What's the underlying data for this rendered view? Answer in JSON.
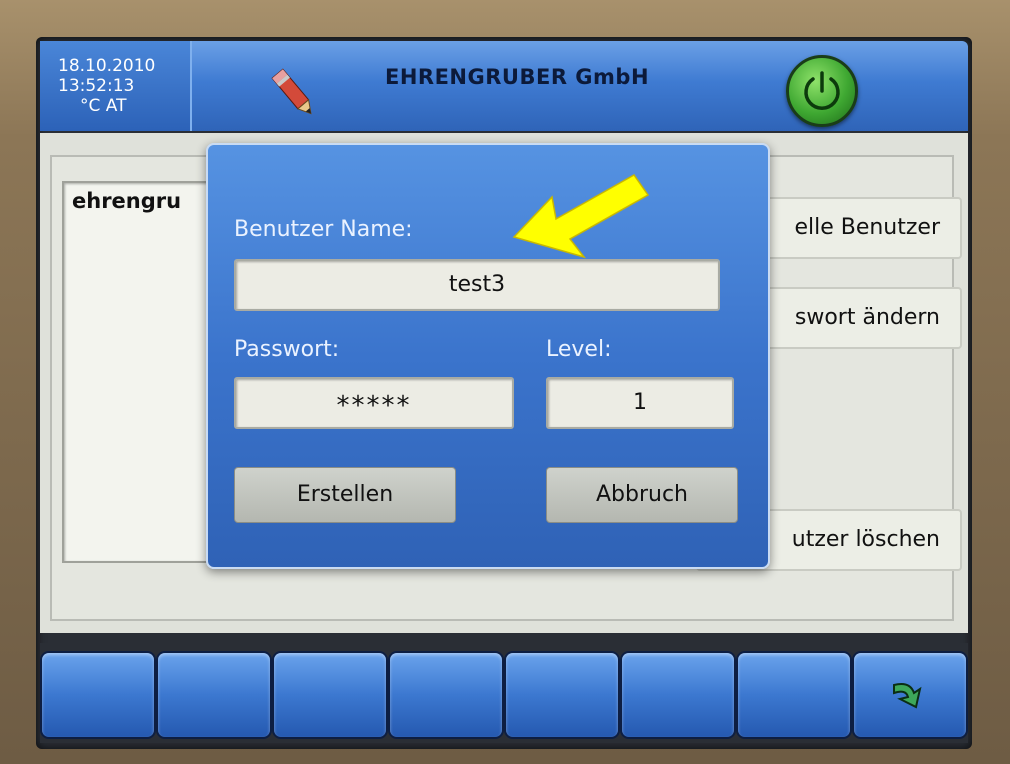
{
  "header": {
    "date": "18.10.2010",
    "time": "13:52:13",
    "units": "°C AT",
    "company": "EHRENGRUBER GmbH",
    "icons": [
      "pencil-icon",
      "power-icon"
    ]
  },
  "main": {
    "list_items": [
      "ehrengru"
    ],
    "buttons": [
      "elle Benutzer",
      "swort ändern",
      "utzer löschen"
    ]
  },
  "dialog": {
    "user_label": "Benutzer Name:",
    "user_value": "test3",
    "password_label": "Passwort:",
    "password_value": "*****",
    "level_label": "Level:",
    "level_value": "1",
    "create_button": "Erstellen",
    "cancel_button": "Abbruch"
  },
  "annotation": {
    "icon": "arrow-pointer-icon",
    "color": "#ffff00"
  },
  "footer": {
    "buttons": 8,
    "last_icon": "return-arrow-icon"
  },
  "colors": {
    "accent_blue": "#3b74cc",
    "power_green": "#3fa832"
  }
}
